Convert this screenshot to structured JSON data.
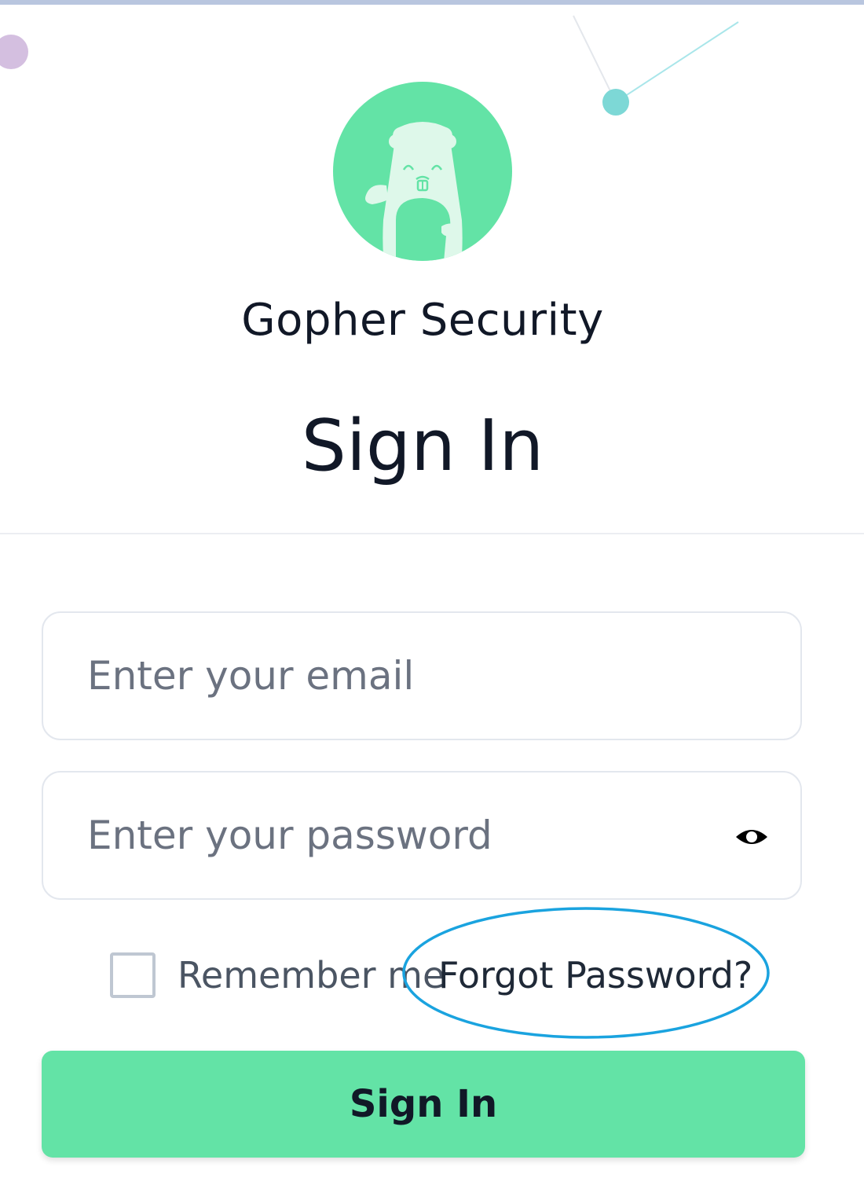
{
  "brand": {
    "name": "Gopher Security",
    "logo_icon": "gopher-mascot-icon",
    "accent_color": "#63e3a6"
  },
  "page": {
    "title": "Sign In"
  },
  "form": {
    "email": {
      "placeholder": "Enter your email",
      "value": ""
    },
    "password": {
      "placeholder": "Enter your password",
      "value": "",
      "toggle_icon": "eye-icon"
    },
    "remember_me": {
      "label": "Remember me",
      "checked": false
    },
    "forgot_password_label": "Forgot Password?",
    "submit_label": "Sign In"
  },
  "annotation": {
    "shape": "ellipse",
    "target": "forgot-password-link",
    "color": "#1aa3df"
  }
}
